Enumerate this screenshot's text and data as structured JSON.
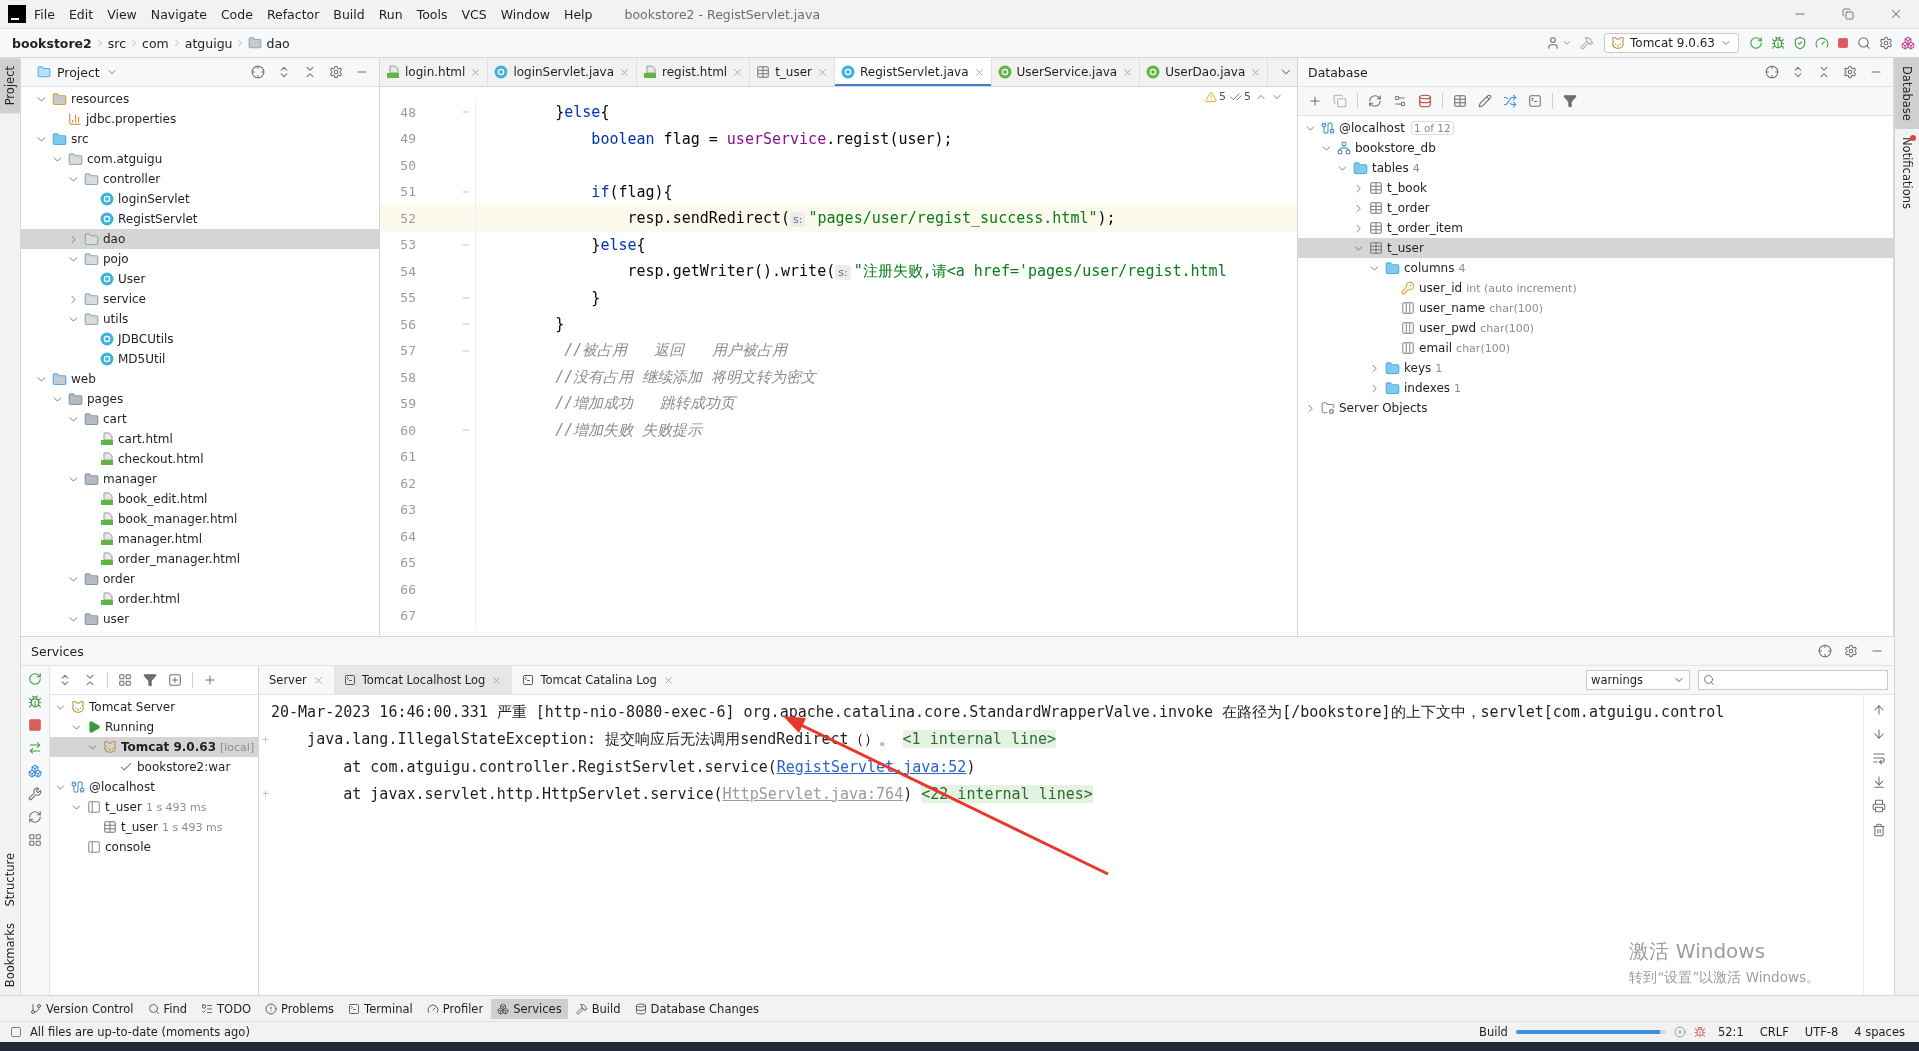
{
  "window": {
    "title": "bookstore2 - RegistServlet.java"
  },
  "menu": [
    "File",
    "Edit",
    "View",
    "Navigate",
    "Code",
    "Refactor",
    "Build",
    "Run",
    "Tools",
    "VCS",
    "Window",
    "Help"
  ],
  "breadcrumb": [
    {
      "label": "bookstore2",
      "kind": "project"
    },
    {
      "label": "src",
      "kind": "plain"
    },
    {
      "label": "com",
      "kind": "plain"
    },
    {
      "label": "atguigu",
      "kind": "plain"
    },
    {
      "label": "dao",
      "kind": "folder"
    }
  ],
  "run_config": {
    "label": "Tomcat 9.0.63"
  },
  "left_stripe": {
    "top": [
      {
        "label": "Project",
        "selected": true
      }
    ],
    "bottom": [
      {
        "label": "Structure",
        "selected": false
      },
      {
        "label": "Bookmarks",
        "selected": false
      }
    ]
  },
  "right_stripe": [
    {
      "label": "Database",
      "selected": true,
      "unread": false
    },
    {
      "label": "Notifications",
      "selected": false,
      "unread": true
    }
  ],
  "project": {
    "title": "Project",
    "tree": [
      {
        "label": "resources",
        "kind": "resources",
        "expanded": true,
        "selected": false,
        "children": [
          {
            "label": "jdbc.properties",
            "kind": "properties",
            "selected": false
          }
        ]
      },
      {
        "label": "src",
        "kind": "source-folder",
        "expanded": true,
        "selected": false,
        "children": [
          {
            "label": "com.atguigu",
            "kind": "package",
            "expanded": true,
            "selected": false,
            "children": [
              {
                "label": "controller",
                "kind": "package",
                "expanded": true,
                "selected": false,
                "children": [
                  {
                    "label": "loginServlet",
                    "kind": "class",
                    "selected": false
                  },
                  {
                    "label": "RegistServlet",
                    "kind": "class",
                    "selected": false
                  }
                ]
              },
              {
                "label": "dao",
                "kind": "package",
                "expanded": false,
                "selected": true
              },
              {
                "label": "pojo",
                "kind": "package",
                "expanded": true,
                "selected": false,
                "children": [
                  {
                    "label": "User",
                    "kind": "class",
                    "selected": false
                  }
                ]
              },
              {
                "label": "service",
                "kind": "package",
                "expanded": false,
                "selected": false
              },
              {
                "label": "utils",
                "kind": "package",
                "expanded": true,
                "selected": false,
                "children": [
                  {
                    "label": "JDBCUtils",
                    "kind": "class",
                    "selected": false
                  },
                  {
                    "label": "MD5Util",
                    "kind": "class",
                    "selected": false
                  }
                ]
              }
            ]
          }
        ]
      },
      {
        "label": "web",
        "kind": "web",
        "expanded": true,
        "selected": false,
        "children": [
          {
            "label": "pages",
            "kind": "folder",
            "expanded": true,
            "selected": false,
            "children": [
              {
                "label": "cart",
                "kind": "folder",
                "expanded": true,
                "selected": false,
                "children": [
                  {
                    "label": "cart.html",
                    "kind": "html",
                    "selected": false
                  },
                  {
                    "label": "checkout.html",
                    "kind": "html",
                    "selected": false
                  }
                ]
              },
              {
                "label": "manager",
                "kind": "folder",
                "expanded": true,
                "selected": false,
                "children": [
                  {
                    "label": "book_edit.html",
                    "kind": "html",
                    "selected": false
                  },
                  {
                    "label": "book_manager.html",
                    "kind": "html",
                    "selected": false
                  },
                  {
                    "label": "manager.html",
                    "kind": "html",
                    "selected": false
                  },
                  {
                    "label": "order_manager.html",
                    "kind": "html",
                    "selected": false
                  }
                ]
              },
              {
                "label": "order",
                "kind": "folder",
                "expanded": true,
                "selected": false,
                "children": [
                  {
                    "label": "order.html",
                    "kind": "html",
                    "selected": false
                  }
                ]
              },
              {
                "label": "user",
                "kind": "folder",
                "expanded": true,
                "selected": false
              }
            ]
          }
        ]
      }
    ]
  },
  "editor": {
    "tabs": [
      {
        "label": "login.html",
        "kind": "html",
        "selected": false
      },
      {
        "label": "loginServlet.java",
        "kind": "class",
        "selected": false
      },
      {
        "label": "regist.html",
        "kind": "html",
        "selected": false
      },
      {
        "label": "t_user",
        "kind": "table",
        "selected": false
      },
      {
        "label": "RegistServlet.java",
        "kind": "class",
        "selected": true
      },
      {
        "label": "UserService.java",
        "kind": "interface",
        "selected": false
      },
      {
        "label": "UserDao.java",
        "kind": "interface",
        "selected": false
      }
    ],
    "inspections": {
      "warnings": "5",
      "passed": "5"
    },
    "lines": [
      {
        "number": "48",
        "fold": true,
        "current": false,
        "tokens": [
          {
            "text": "        }",
            "kind": "plain"
          },
          {
            "text": "else",
            "kind": "keyword"
          },
          {
            "text": "{",
            "kind": "plain"
          }
        ]
      },
      {
        "number": "49",
        "fold": false,
        "current": false,
        "tokens": [
          {
            "text": "            boolean",
            "kind": "keyword"
          },
          {
            "text": " flag = ",
            "kind": "plain"
          },
          {
            "text": "userService",
            "kind": "field"
          },
          {
            "text": ".regist(user);",
            "kind": "plain"
          }
        ]
      },
      {
        "number": "50",
        "fold": false,
        "current": false
      },
      {
        "number": "51",
        "fold": true,
        "current": false,
        "tokens": [
          {
            "text": "            if",
            "kind": "keyword"
          },
          {
            "text": "(flag){",
            "kind": "plain"
          }
        ]
      },
      {
        "number": "52",
        "fold": false,
        "current": true,
        "tokens": [
          {
            "text": "                resp.sendRedirect(",
            "kind": "plain"
          },
          {
            "text": "s:",
            "kind": "hint"
          },
          {
            "text": "\"pages/user/regist_success.html\"",
            "kind": "string"
          },
          {
            "text": ");",
            "kind": "plain"
          }
        ]
      },
      {
        "number": "53",
        "fold": true,
        "current": false,
        "tokens": [
          {
            "text": "            }",
            "kind": "plain"
          },
          {
            "text": "else",
            "kind": "keyword"
          },
          {
            "text": "{",
            "kind": "plain"
          }
        ]
      },
      {
        "number": "54",
        "fold": false,
        "current": false,
        "tokens": [
          {
            "text": "                resp.getWriter().write(",
            "kind": "plain"
          },
          {
            "text": "s:",
            "kind": "hint"
          },
          {
            "text": "\"注册失败,请<a href='pages/user/regist.html",
            "kind": "string"
          }
        ]
      },
      {
        "number": "55",
        "fold": true,
        "current": false,
        "tokens": [
          {
            "text": "            }",
            "kind": "plain"
          }
        ]
      },
      {
        "number": "56",
        "fold": true,
        "current": false,
        "tokens": [
          {
            "text": "        }",
            "kind": "plain"
          }
        ]
      },
      {
        "number": "57",
        "fold": true,
        "current": false,
        "tokens": [
          {
            "text": "         //被占用   返回   用户被占用",
            "kind": "comment"
          }
        ]
      },
      {
        "number": "58",
        "fold": false,
        "current": false,
        "tokens": [
          {
            "text": "        //没有占用 继续添加 将明文转为密文",
            "kind": "comment"
          }
        ]
      },
      {
        "number": "59",
        "fold": false,
        "current": false,
        "tokens": [
          {
            "text": "        //增加成功   跳转成功页",
            "kind": "comment"
          }
        ]
      },
      {
        "number": "60",
        "fold": true,
        "current": false,
        "tokens": [
          {
            "text": "        //增加失败 失败提示",
            "kind": "comment"
          }
        ]
      },
      {
        "number": "61",
        "fold": false,
        "current": false
      },
      {
        "number": "62",
        "fold": false,
        "current": false
      },
      {
        "number": "63",
        "fold": false,
        "current": false
      },
      {
        "number": "64",
        "fold": false,
        "current": false
      },
      {
        "number": "65",
        "fold": false,
        "current": false
      },
      {
        "number": "66",
        "fold": false,
        "current": false
      },
      {
        "number": "67",
        "fold": false,
        "current": false
      }
    ]
  },
  "database": {
    "title": "Database",
    "tree": [
      {
        "label": "@localhost",
        "kind": "connection",
        "badge": "1 of 12",
        "expanded": true,
        "selected": false,
        "children": [
          {
            "label": "bookstore_db",
            "kind": "schema",
            "expanded": true,
            "selected": false,
            "children": [
              {
                "label": "tables",
                "kind": "folder",
                "meta": "4",
                "expanded": true,
                "selected": false,
                "children": [
                  {
                    "label": "t_book",
                    "kind": "table",
                    "expanded": false,
                    "selected": false
                  },
                  {
                    "label": "t_order",
                    "kind": "table",
                    "expanded": false,
                    "selected": false
                  },
                  {
                    "label": "t_order_item",
                    "kind": "table",
                    "expanded": false,
                    "selected": false
                  },
                  {
                    "label": "t_user",
                    "kind": "table",
                    "expanded": true,
                    "selected": true,
                    "children": [
                      {
                        "label": "columns",
                        "kind": "folder",
                        "meta": "4",
                        "expanded": true,
                        "selected": false,
                        "children": [
                          {
                            "label": "user_id",
                            "kind": "key-column",
                            "meta": "int (auto increment)",
                            "selected": false
                          },
                          {
                            "label": "user_name",
                            "kind": "column",
                            "meta": "char(100)",
                            "selected": false
                          },
                          {
                            "label": "user_pwd",
                            "kind": "column",
                            "meta": "char(100)",
                            "selected": false
                          },
                          {
                            "label": "email",
                            "kind": "column",
                            "meta": "char(100)",
                            "selected": false
                          }
                        ]
                      },
                      {
                        "label": "keys",
                        "kind": "folder",
                        "meta": "1",
                        "expanded": false,
                        "selected": false
                      },
                      {
                        "label": "indexes",
                        "kind": "folder",
                        "meta": "1",
                        "expanded": false,
                        "selected": false
                      }
                    ]
                  }
                ]
              }
            ]
          }
        ]
      },
      {
        "label": "Server Objects",
        "kind": "server-objects",
        "expanded": false,
        "selected": false
      }
    ]
  },
  "services": {
    "title": "Services",
    "tree": [
      {
        "label": "Tomcat Server",
        "kind": "tomcat",
        "expanded": true,
        "selected": false,
        "children": [
          {
            "label": "Running",
            "kind": "running",
            "expanded": true,
            "selected": false,
            "children": [
              {
                "label": "Tomcat 9.0.63",
                "kind": "instance",
                "meta": "[local]",
                "expanded": true,
                "selected": true,
                "children": [
                  {
                    "label": "bookstore2:war",
                    "kind": "artifact",
                    "selected": false
                  }
                ]
              }
            ]
          }
        ]
      },
      {
        "label": "@localhost",
        "kind": "connection",
        "expanded": true,
        "selected": false,
        "children": [
          {
            "label": "t_user",
            "kind": "session",
            "meta": "1 s 493 ms",
            "expanded": true,
            "selected": false,
            "children": [
              {
                "label": "t_user",
                "kind": "table",
                "meta": "1 s 493 ms",
                "selected": false
              }
            ]
          },
          {
            "label": "console",
            "kind": "session",
            "selected": false
          }
        ]
      }
    ],
    "log_tabs": [
      {
        "label": "Server",
        "kind": "server",
        "selected": false
      },
      {
        "label": "Tomcat Localhost Log",
        "kind": "log",
        "selected": true
      },
      {
        "label": "Tomcat Catalina Log",
        "kind": "log",
        "selected": false
      }
    ],
    "filter": {
      "value": "warnings"
    },
    "log": [
      {
        "fold": false,
        "tokens": [
          {
            "text": "20-Mar-2023 16:46:00.331 严重 [http-nio-8080-exec-6] org.apache.catalina.core.StandardWrapperValve.invoke 在路径为[/bookstore]的上下文中，servlet[com.atguigu.control",
            "kind": "plain"
          }
        ]
      },
      {
        "fold": true,
        "tokens": [
          {
            "text": "    java.lang.IllegalStateException: 提交响应后无法调用sendRedirect（）。 ",
            "kind": "plain"
          },
          {
            "text": "<1 internal line>",
            "kind": "folded"
          }
        ]
      },
      {
        "fold": false,
        "tokens": [
          {
            "text": "        at com.atguigu.controller.RegistServlet.service(",
            "kind": "plain"
          },
          {
            "text": "RegistServlet.java:52",
            "kind": "link"
          },
          {
            "text": ")",
            "kind": "plain"
          }
        ]
      },
      {
        "fold": true,
        "tokens": [
          {
            "text": "        at javax.servlet.http.HttpServlet.service(",
            "kind": "plain"
          },
          {
            "text": "HttpServlet.java:764",
            "kind": "muted-link"
          },
          {
            "text": ") ",
            "kind": "plain"
          },
          {
            "text": "<22 internal lines>",
            "kind": "folded"
          }
        ]
      }
    ]
  },
  "windows_activation": {
    "title": "激活 Windows",
    "subtitle": "转到“设置”以激活 Windows。"
  },
  "tool_windows": [
    {
      "label": "Version Control",
      "selected": false
    },
    {
      "label": "Find",
      "selected": false
    },
    {
      "label": "TODO",
      "selected": false
    },
    {
      "label": "Problems",
      "selected": false
    },
    {
      "label": "Terminal",
      "selected": false
    },
    {
      "label": "Profiler",
      "selected": false
    },
    {
      "label": "Services",
      "selected": true
    },
    {
      "label": "Build",
      "selected": false
    },
    {
      "label": "Database Changes",
      "selected": false
    }
  ],
  "status": {
    "message": "All files are up-to-date (moments ago)",
    "build": {
      "label": "Build",
      "level": 0.96
    },
    "position": "52:1",
    "line_separator": "CRLF",
    "encoding": "UTF-8",
    "indent": "4 spaces"
  }
}
